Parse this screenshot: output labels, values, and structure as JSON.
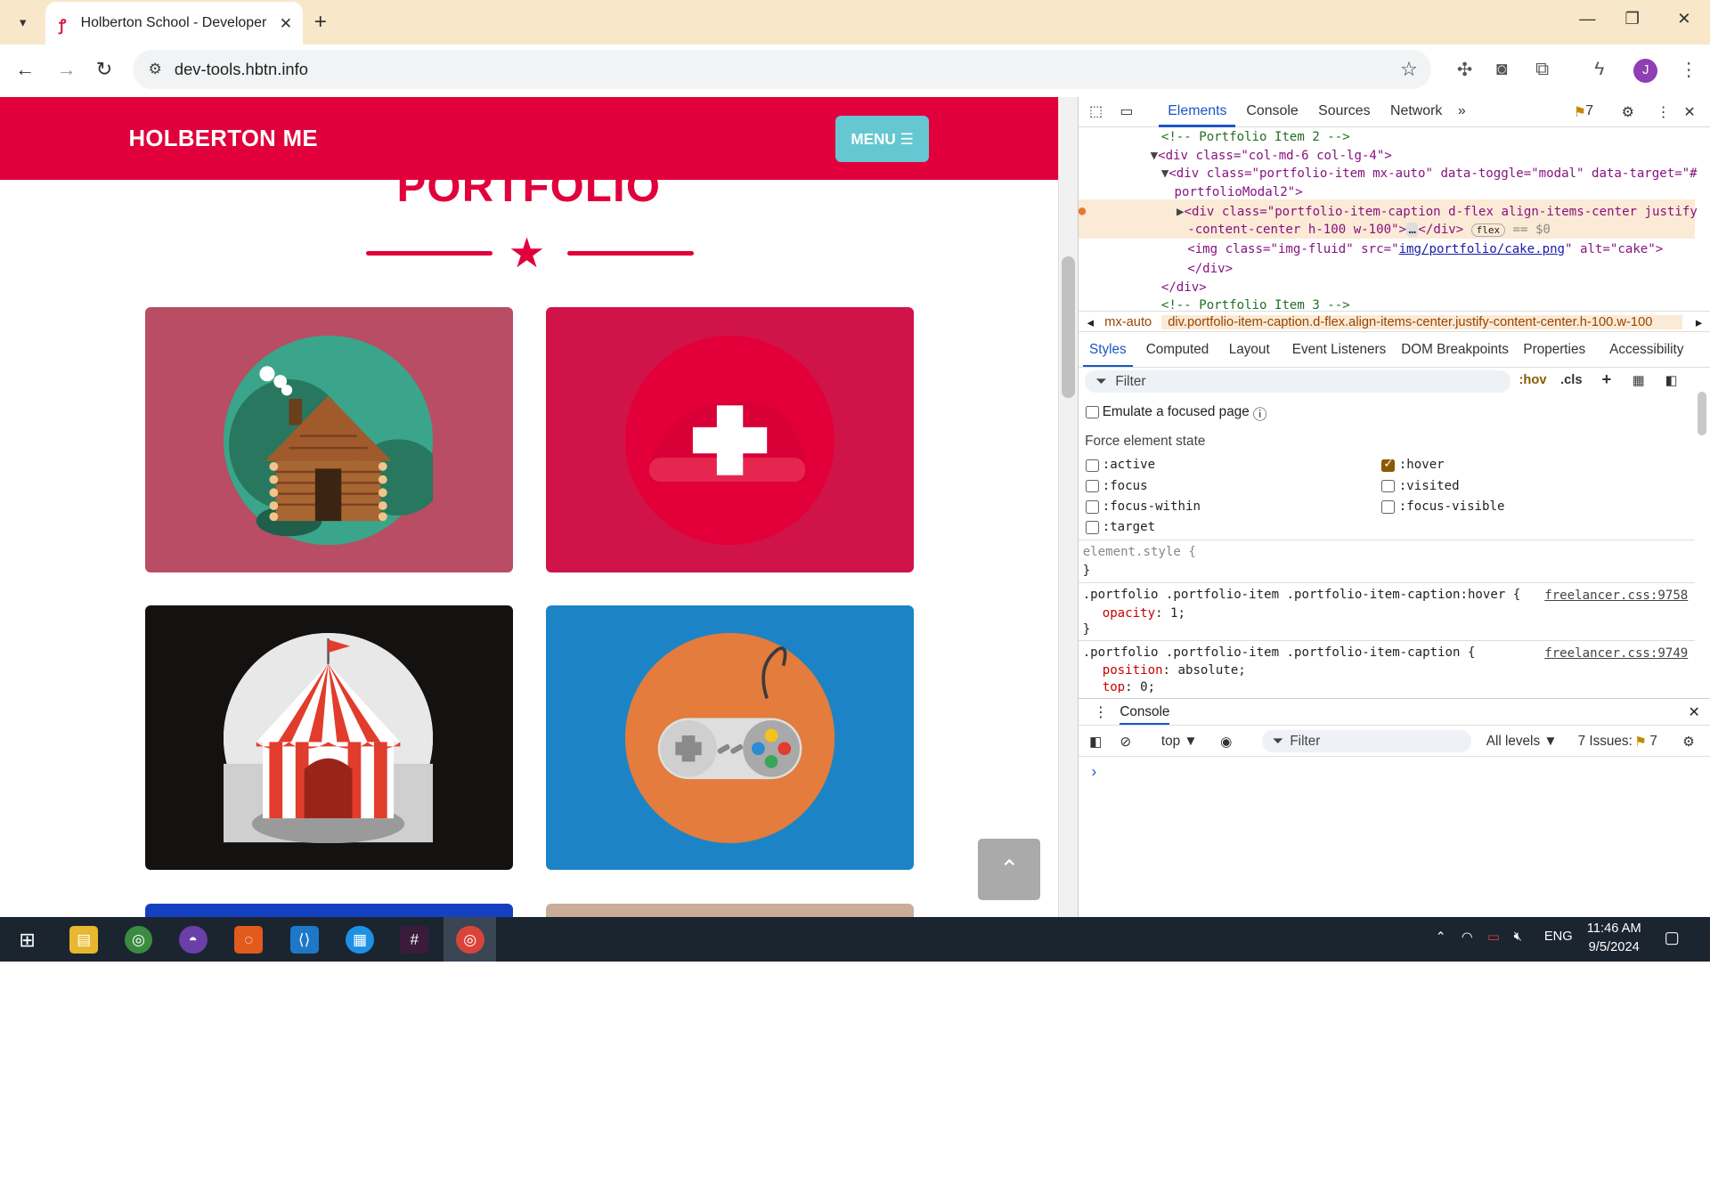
{
  "browser": {
    "tab_title": "Holberton School - Developer t",
    "url": "dev-tools.hbtn.info",
    "avatar_letter": "J"
  },
  "site": {
    "brand": "HOLBERTON ME",
    "menu_label": "MENU ☰",
    "section_title": "PORTFOLIO",
    "colors": {
      "primary": "#e1003c",
      "menu_bg": "#64c7d1"
    },
    "cards": [
      {
        "name": "cabin",
        "bg": "#b94d63",
        "circle": "#2f9a7f"
      },
      {
        "name": "cake",
        "bg": "#d01449",
        "circle": "#e3003a"
      },
      {
        "name": "circus",
        "bg": "#141111",
        "circle": "#e8e8e8"
      },
      {
        "name": "game",
        "bg": "#1c84c6",
        "circle": "#e37c3c"
      }
    ]
  },
  "devtools": {
    "tabs": [
      "Elements",
      "Console",
      "Sources",
      "Network"
    ],
    "issues_badge": "7",
    "dom_lines": [
      "<!-- Portfolio Item 2 -->",
      "<div class=\"col-md-6 col-lg-4\">",
      "<div class=\"portfolio-item mx-auto\" data-toggle=\"modal\" data-target=\"#",
      "portfolioModal2\">",
      "<div class=\"portfolio-item-caption d-flex align-items-center justify",
      "-content-center h-100 w-100\">",
      "</div>",
      "flex",
      "== $0",
      "<img class=\"img-fluid\" src=\"",
      "img/portfolio/cake.png",
      "\" alt=\"cake\">",
      "</div>",
      "</div>",
      "<!-- Portfolio Item 3 -->"
    ],
    "breadcrumbs": [
      "mx-auto",
      "div.portfolio-item-caption.d-flex.align-items-center.justify-content-center.h-100.w-100"
    ],
    "subtabs": [
      "Styles",
      "Computed",
      "Layout",
      "Event Listeners",
      "DOM Breakpoints",
      "Properties",
      "Accessibility"
    ],
    "filter_placeholder": "Filter",
    "hov": ":hov",
    "cls": ".cls",
    "emulate_focus": "Emulate a focused page",
    "force_state_title": "Force element state",
    "states": [
      {
        "label": ":active",
        "checked": false
      },
      {
        "label": ":hover",
        "checked": true
      },
      {
        "label": ":focus",
        "checked": false
      },
      {
        "label": ":visited",
        "checked": false
      },
      {
        "label": ":focus-within",
        "checked": false
      },
      {
        "label": ":focus-visible",
        "checked": false
      },
      {
        "label": ":target",
        "checked": false
      }
    ],
    "rules": {
      "element_style": "element.style {",
      "close": "}",
      "r1_selector": ".portfolio .portfolio-item .portfolio-item-caption:hover {",
      "r1_source": "freelancer.css:9758",
      "r1_prop": "opacity",
      "r1_val": "1;",
      "r2_selector": ".portfolio .portfolio-item .portfolio-item-caption {",
      "r2_source": "freelancer.css:9749",
      "r2_p1": "position",
      "r2_v1": "absolute;",
      "r2_p2": "top",
      "r2_v2": "0;"
    },
    "drawer": {
      "title": "Console",
      "context": "top ▼",
      "filter_placeholder": "Filter",
      "levels": "All levels ▼",
      "issues": "7 Issues:",
      "issues_count": "7",
      "prompt": "›"
    }
  },
  "taskbar": {
    "language": "ENG",
    "time": "11:46 AM",
    "date": "9/5/2024"
  }
}
